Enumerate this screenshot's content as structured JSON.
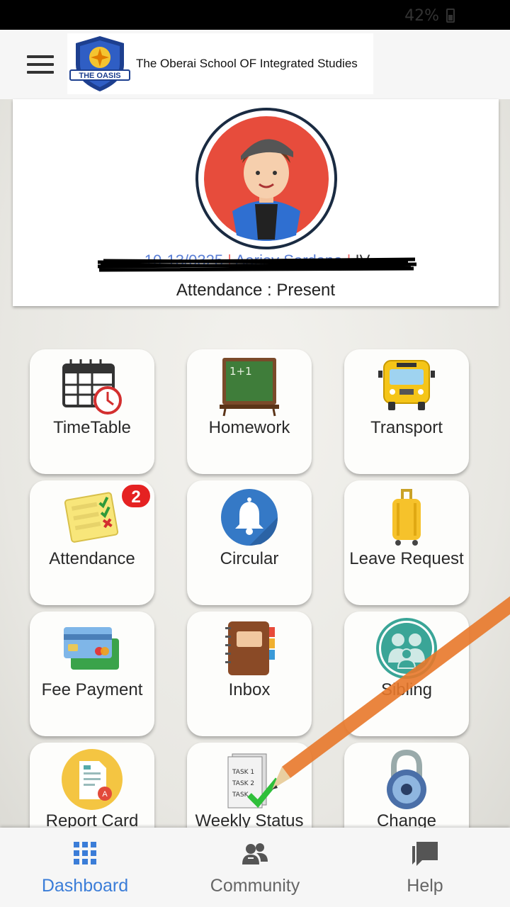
{
  "status_bar": {
    "battery": "42%"
  },
  "header": {
    "school_name": "The Oberai School OF Integrated Studies",
    "logo_text": "THE OASIS"
  },
  "profile": {
    "student_line": {
      "admission": "10-13/0325",
      "name": "Aarjav Sardana",
      "class": "IV"
    },
    "attendance": "Attendance : Present"
  },
  "tiles": [
    {
      "label": "TimeTable",
      "icon": "calendar-clock-icon"
    },
    {
      "label": "Homework",
      "icon": "chalkboard-icon"
    },
    {
      "label": "Transport",
      "icon": "school-bus-icon"
    },
    {
      "label": "Attendance",
      "icon": "checklist-icon",
      "badge": "2"
    },
    {
      "label": "Circular",
      "icon": "bell-icon"
    },
    {
      "label": "Leave Request",
      "icon": "suitcase-icon"
    },
    {
      "label": "Fee Payment",
      "icon": "credit-card-icon"
    },
    {
      "label": "Inbox",
      "icon": "notebook-icon"
    },
    {
      "label": "Sibling",
      "icon": "family-icon"
    },
    {
      "label": "Report Card",
      "icon": "report-card-icon"
    },
    {
      "label": "Weekly Status",
      "icon": "task-report-icon"
    },
    {
      "label": "Change",
      "icon": "padlock-icon"
    }
  ],
  "bottom_nav": [
    {
      "label": "Dashboard",
      "icon": "grid-icon",
      "active": true
    },
    {
      "label": "Community",
      "icon": "people-icon",
      "active": false
    },
    {
      "label": "Help",
      "icon": "chat-bubble-icon",
      "active": false
    }
  ],
  "colors": {
    "accent": "#3b7dd8",
    "badge": "#e52222",
    "avatar_bg": "#e74c3c"
  }
}
